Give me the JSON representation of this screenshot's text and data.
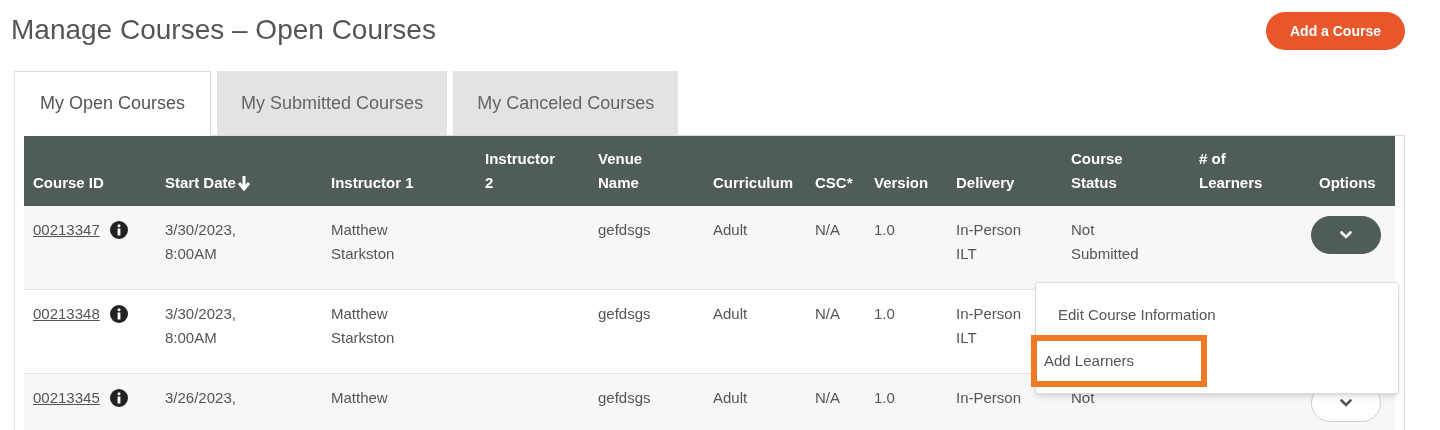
{
  "title": "Manage Courses – Open Courses",
  "add_button": "Add a Course",
  "tabs": [
    {
      "label": "My Open Courses",
      "selected": true
    },
    {
      "label": "My Submitted Courses",
      "selected": false
    },
    {
      "label": "My Canceled Courses",
      "selected": false
    }
  ],
  "table": {
    "columns": [
      {
        "label": "Course ID",
        "sorted": false
      },
      {
        "label": "Start Date",
        "sorted": true
      },
      {
        "label": "Instructor 1",
        "sorted": false
      },
      {
        "label": "Instructor 2",
        "sorted": false
      },
      {
        "label": "Venue Name",
        "sorted": false
      },
      {
        "label": "Curriculum",
        "sorted": false
      },
      {
        "label": "CSC*",
        "sorted": false
      },
      {
        "label": "Version",
        "sorted": false
      },
      {
        "label": "Delivery",
        "sorted": false
      },
      {
        "label": "Course Status",
        "sorted": false
      },
      {
        "label": "# of Learners",
        "sorted": false
      },
      {
        "label": "Options",
        "sorted": false
      }
    ],
    "rows": [
      {
        "course_id": "00213347",
        "start_date": "3/30/2023, 8:00AM",
        "instructor_1": "Matthew Starkston",
        "venue": "gefdsgs",
        "curriculum": "Adult",
        "csc": "N/A",
        "version": "1.0",
        "delivery": "In-Person ILT",
        "status": "Not Submitted",
        "options": {
          "kind": "filled"
        }
      },
      {
        "course_id": "00213348",
        "start_date": "3/30/2023, 8:00AM",
        "instructor_1": "Matthew Starkston",
        "venue": "gefdsgs",
        "curriculum": "Adult",
        "csc": "N/A",
        "version": "1.0",
        "delivery": "In-Person ILT"
      },
      {
        "course_id": "00213345",
        "start_date": "3/26/2023,",
        "instructor_1": "Matthew",
        "venue": "gefdsgs",
        "curriculum": "Adult",
        "csc": "N/A",
        "version": "1.0",
        "delivery": "In-Person",
        "status": "Not",
        "options": {
          "kind": "outline"
        }
      }
    ]
  },
  "options_menu": {
    "items": [
      {
        "label": "Edit Course Information",
        "highlighted": false
      },
      {
        "label": "Add Learners",
        "highlighted": true
      }
    ]
  }
}
